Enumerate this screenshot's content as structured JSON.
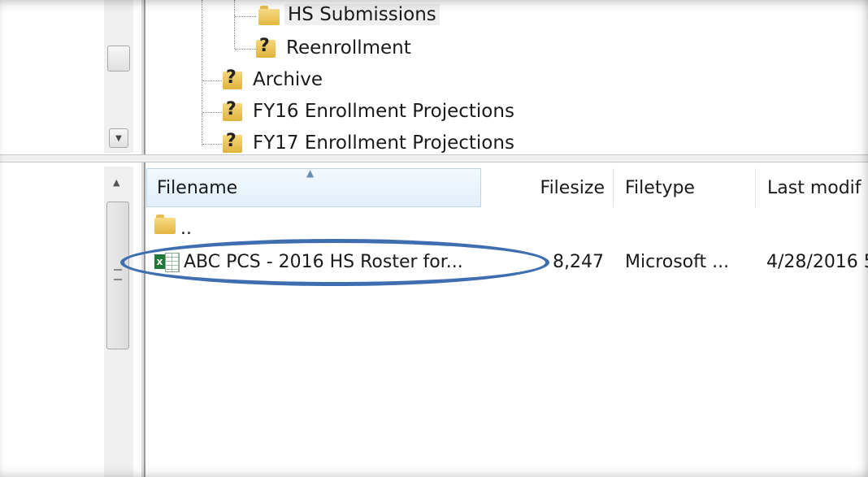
{
  "tree": {
    "items": [
      {
        "label": "HS Submissions",
        "icon": "folder-icon",
        "selected": true
      },
      {
        "label": "Reenrollment",
        "icon": "unknown-folder-icon"
      },
      {
        "label": "Archive",
        "icon": "unknown-folder-icon"
      },
      {
        "label": "FY16 Enrollment Projections",
        "icon": "unknown-folder-icon"
      },
      {
        "label": "FY17 Enrollment Projections",
        "icon": "unknown-folder-icon"
      }
    ]
  },
  "file_list": {
    "columns": {
      "filename": "Filename",
      "filesize": "Filesize",
      "filetype": "Filetype",
      "last_modified": "Last modif"
    },
    "rows": [
      {
        "filename": "..",
        "filesize": "",
        "filetype": "",
        "last_modified": "",
        "icon": "folder-icon"
      },
      {
        "filename": "ABC PCS - 2016 HS Roster for...",
        "filesize": "8,247",
        "filetype": "Microsoft ...",
        "last_modified": "4/28/2016 5",
        "icon": "excel-file-icon"
      }
    ]
  },
  "annotation": {
    "color": "#3e6db0",
    "shape": "ellipse"
  }
}
